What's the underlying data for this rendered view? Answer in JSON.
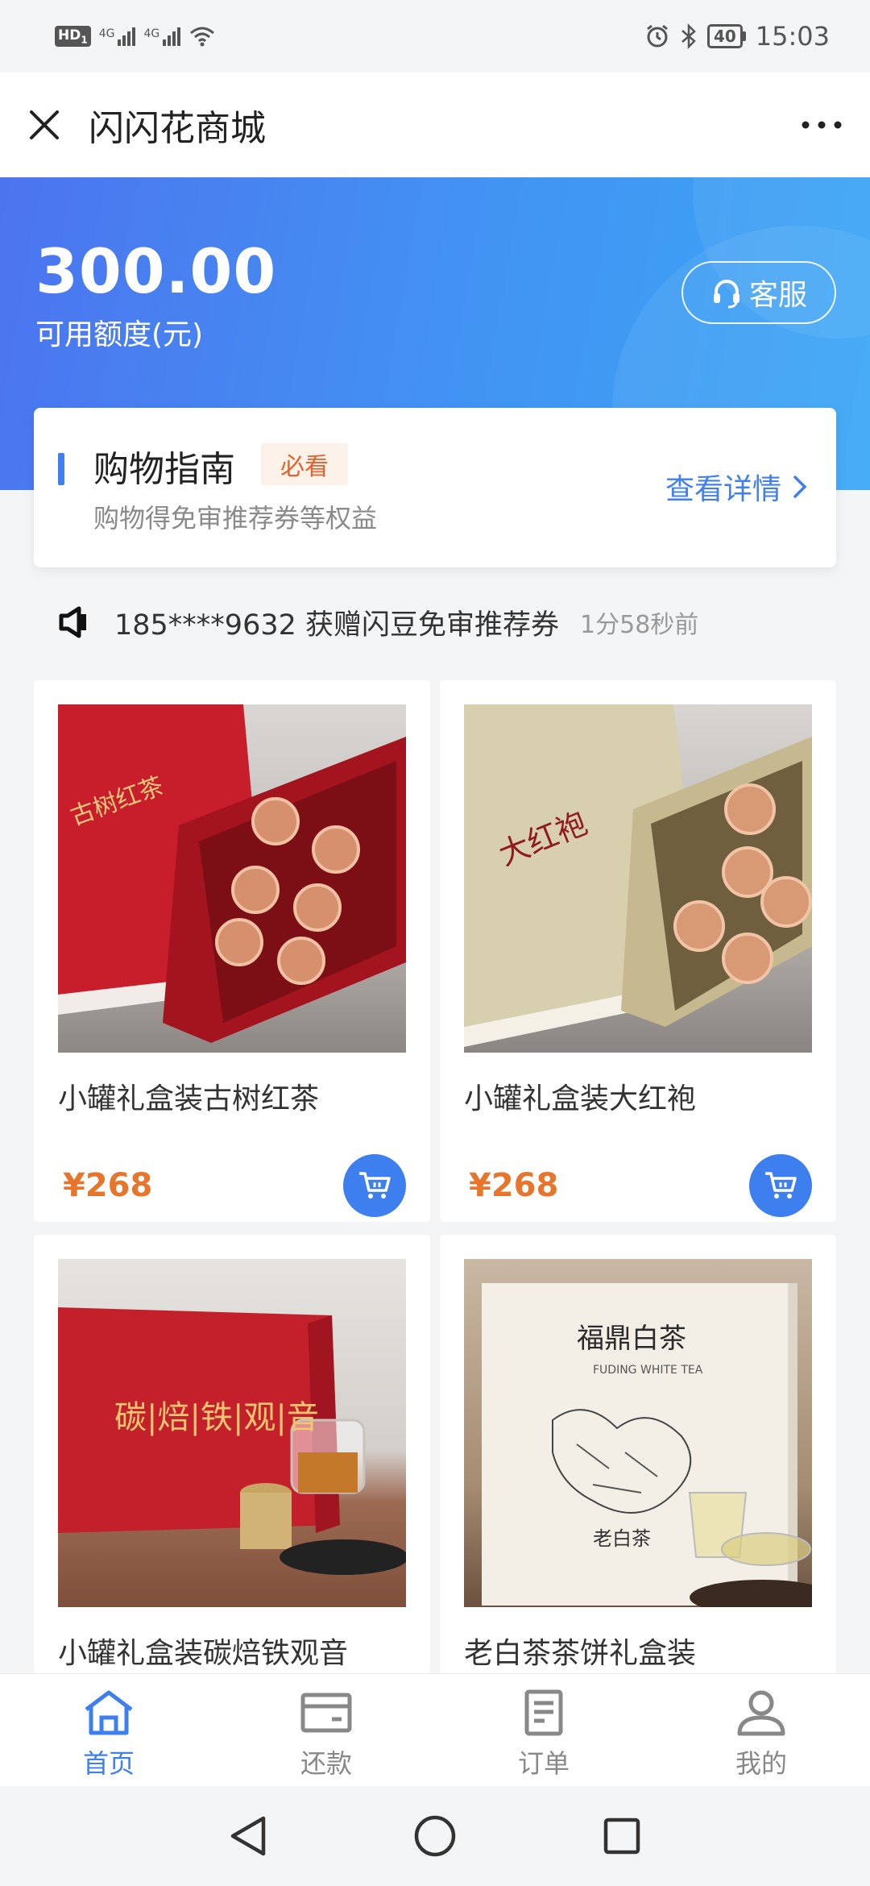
{
  "status_bar": {
    "hd": "HD",
    "sim_index": "1",
    "network_1": "4G",
    "network_2": "4G",
    "battery": "40",
    "time": "15:03"
  },
  "header": {
    "title": "闪闪花商城"
  },
  "account": {
    "balance": "300.00",
    "balance_label": "可用额度(元)",
    "service_label": "客服"
  },
  "guide": {
    "title": "购物指南",
    "badge": "必看",
    "description": "购物得免审推荐券等权益",
    "link_label": "查看详情"
  },
  "notice": {
    "text": "185****9632 获赠闪豆免审推荐券",
    "time": "1分58秒前"
  },
  "products": [
    {
      "name": "小罐礼盒装古树红茶",
      "price": "¥268",
      "image_label": "古树红茶"
    },
    {
      "name": "小罐礼盒装大红袍",
      "price": "¥268",
      "image_label": "大红袍"
    },
    {
      "name": "小罐礼盒装碳焙铁观音",
      "image_label": "碳|焙|铁|观|音"
    },
    {
      "name": "老白茶茶饼礼盒装",
      "image_label": "福鼎白茶",
      "image_sublabel": "FUDING WHITE TEA",
      "image_bottom_label": "老白茶"
    }
  ],
  "tabs": [
    {
      "label": "首页",
      "icon": "home-icon"
    },
    {
      "label": "还款",
      "icon": "card-icon"
    },
    {
      "label": "订单",
      "icon": "document-icon"
    },
    {
      "label": "我的",
      "icon": "user-icon"
    }
  ],
  "colors": {
    "accent": "#3d7fef",
    "price": "#e8752c",
    "badge_text": "#e5622d",
    "hero_start": "#4c74ef",
    "hero_end": "#3aa6f6"
  }
}
